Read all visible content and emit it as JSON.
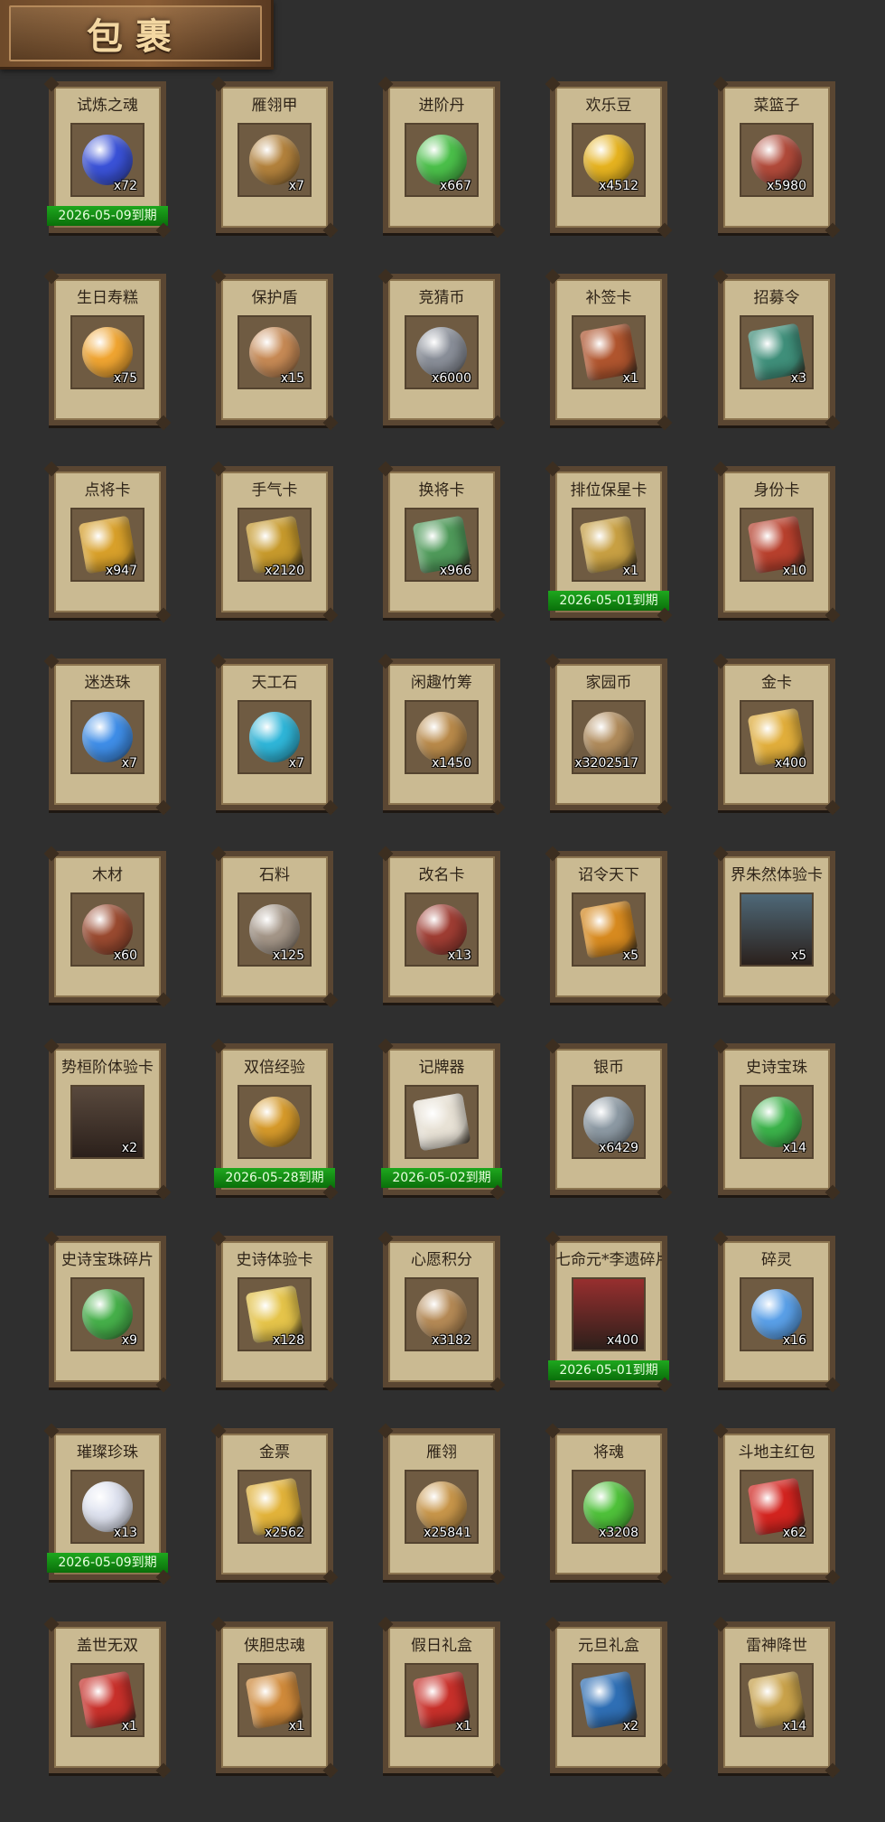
{
  "title": "包裹",
  "items": [
    {
      "name": "试炼之魂",
      "count": "x72",
      "expiry": "2026-05-09到期",
      "icon": "blue-orb-icon",
      "color": "#3a52d8"
    },
    {
      "name": "雁翎甲",
      "count": "x7",
      "expiry": "",
      "icon": "armor-icon",
      "color": "#b3823c"
    },
    {
      "name": "进阶丹",
      "count": "x667",
      "expiry": "",
      "icon": "green-pill-icon",
      "color": "#4bc04a"
    },
    {
      "name": "欢乐豆",
      "count": "x4512",
      "expiry": "",
      "icon": "gold-beans-icon",
      "color": "#e6b31f"
    },
    {
      "name": "菜篮子",
      "count": "x5980",
      "expiry": "",
      "icon": "basket-icon",
      "color": "#b14a3a"
    },
    {
      "name": "生日寿糕",
      "count": "x75",
      "expiry": "",
      "icon": "cake-icon",
      "color": "#f0a531"
    },
    {
      "name": "保护盾",
      "count": "x15",
      "expiry": "",
      "icon": "shield-icon",
      "color": "#c78a55"
    },
    {
      "name": "竞猜币",
      "count": "x6000",
      "expiry": "",
      "icon": "silver-coin-icon",
      "color": "#8a8f99"
    },
    {
      "name": "补签卡",
      "count": "x1",
      "expiry": "",
      "icon": "token-card-icon",
      "color": "#b0552e"
    },
    {
      "name": "招募令",
      "count": "x3",
      "expiry": "",
      "icon": "recruit-order-icon",
      "color": "#3f8f7a"
    },
    {
      "name": "点将卡",
      "count": "x947",
      "expiry": "",
      "icon": "general-card-icon",
      "color": "#d8a02a"
    },
    {
      "name": "手气卡",
      "count": "x2120",
      "expiry": "",
      "icon": "luck-card-icon",
      "color": "#c79a2c"
    },
    {
      "name": "换将卡",
      "count": "x966",
      "expiry": "",
      "icon": "swap-card-icon",
      "color": "#4f9a5a"
    },
    {
      "name": "排位保星卡",
      "count": "x1",
      "expiry": "2026-05-01到期",
      "icon": "star-card-icon",
      "color": "#c8a043"
    },
    {
      "name": "身份卡",
      "count": "x10",
      "expiry": "",
      "icon": "mask-card-icon",
      "color": "#b8402d"
    },
    {
      "name": "迷迭珠",
      "count": "x7",
      "expiry": "",
      "icon": "blue-pearl-icon",
      "color": "#3f8ee8"
    },
    {
      "name": "天工石",
      "count": "x7",
      "expiry": "",
      "icon": "crystal-icon",
      "color": "#2fb6d9"
    },
    {
      "name": "闲趣竹筹",
      "count": "x1450",
      "expiry": "",
      "icon": "bamboo-token-icon",
      "color": "#b98a4a"
    },
    {
      "name": "家园币",
      "count": "x3202517",
      "expiry": "",
      "icon": "bronze-coin-icon",
      "color": "#b08b5b"
    },
    {
      "name": "金卡",
      "count": "x400",
      "expiry": "",
      "icon": "gold-card-icon",
      "color": "#e1ae3b"
    },
    {
      "name": "木材",
      "count": "x60",
      "expiry": "",
      "icon": "wood-icon",
      "color": "#9a4a30"
    },
    {
      "name": "石料",
      "count": "x125",
      "expiry": "",
      "icon": "stone-icon",
      "color": "#a49688"
    },
    {
      "name": "改名卡",
      "count": "x13",
      "expiry": "",
      "icon": "rename-tag-icon",
      "color": "#9f3d33"
    },
    {
      "name": "诏令天下",
      "count": "x5",
      "expiry": "",
      "icon": "scroll-icon",
      "color": "#d78a1f"
    },
    {
      "name": "界朱然体验卡",
      "count": "x5",
      "expiry": "",
      "icon": "hero-portrait-icon",
      "color": "#4f6a7a"
    },
    {
      "name": "势桓阶体验卡",
      "count": "x2",
      "expiry": "",
      "icon": "hero-portrait-icon",
      "color": "#5a4a3e"
    },
    {
      "name": "双倍经验",
      "count": "",
      "expiry": "2026-05-28到期",
      "icon": "ruyi-icon",
      "color": "#d69a2a"
    },
    {
      "name": "记牌器",
      "count": "",
      "expiry": "2026-05-02到期",
      "icon": "playing-cards-icon",
      "color": "#e8e2d6"
    },
    {
      "name": "银币",
      "count": "x6429",
      "expiry": "",
      "icon": "silver-coins-icon",
      "color": "#8d9aa4"
    },
    {
      "name": "史诗宝珠",
      "count": "x14",
      "expiry": "",
      "icon": "green-orb-icon",
      "color": "#3bb34a"
    },
    {
      "name": "史诗宝珠碎片",
      "count": "x9",
      "expiry": "",
      "icon": "green-shard-icon",
      "color": "#46b04a"
    },
    {
      "name": "史诗体验卡",
      "count": "x128",
      "expiry": "",
      "icon": "gold-ticket-icon",
      "color": "#e5c44a"
    },
    {
      "name": "心愿积分",
      "count": "x3182",
      "expiry": "",
      "icon": "heart-coin-icon",
      "color": "#b58a56"
    },
    {
      "name": "七命元*李遗碎片",
      "count": "x400",
      "expiry": "2026-05-01到期",
      "icon": "hero-portrait-icon",
      "color": "#9a2f2f"
    },
    {
      "name": "碎灵",
      "count": "x16",
      "expiry": "",
      "icon": "ice-crystal-icon",
      "color": "#5aa0e8"
    },
    {
      "name": "璀璨珍珠",
      "count": "x13",
      "expiry": "2026-05-09到期",
      "icon": "pearl-icon",
      "color": "#dfe3f0"
    },
    {
      "name": "金票",
      "count": "x2562",
      "expiry": "",
      "icon": "gold-scroll-icon",
      "color": "#e2b33a"
    },
    {
      "name": "雁翎",
      "count": "x25841",
      "expiry": "",
      "icon": "feather-icon",
      "color": "#c8964a"
    },
    {
      "name": "将魂",
      "count": "x3208",
      "expiry": "",
      "icon": "green-crystal-icon",
      "color": "#4fc23a"
    },
    {
      "name": "斗地主红包",
      "count": "x62",
      "expiry": "",
      "icon": "red-envelope-icon",
      "color": "#d3241f"
    },
    {
      "name": "盖世无双",
      "count": "x1",
      "expiry": "",
      "icon": "gift-box-icon",
      "color": "#c8302a"
    },
    {
      "name": "侠胆忠魂",
      "count": "x1",
      "expiry": "",
      "icon": "gift-box-icon",
      "color": "#d08a3a"
    },
    {
      "name": "假日礼盒",
      "count": "x1",
      "expiry": "",
      "icon": "gift-box-icon",
      "color": "#c8302a"
    },
    {
      "name": "元旦礼盒",
      "count": "x2",
      "expiry": "",
      "icon": "gift-box-icon",
      "color": "#2f6fb5"
    },
    {
      "name": "雷神降世",
      "count": "x14",
      "expiry": "",
      "icon": "gift-box-icon",
      "color": "#c9a24a"
    }
  ]
}
